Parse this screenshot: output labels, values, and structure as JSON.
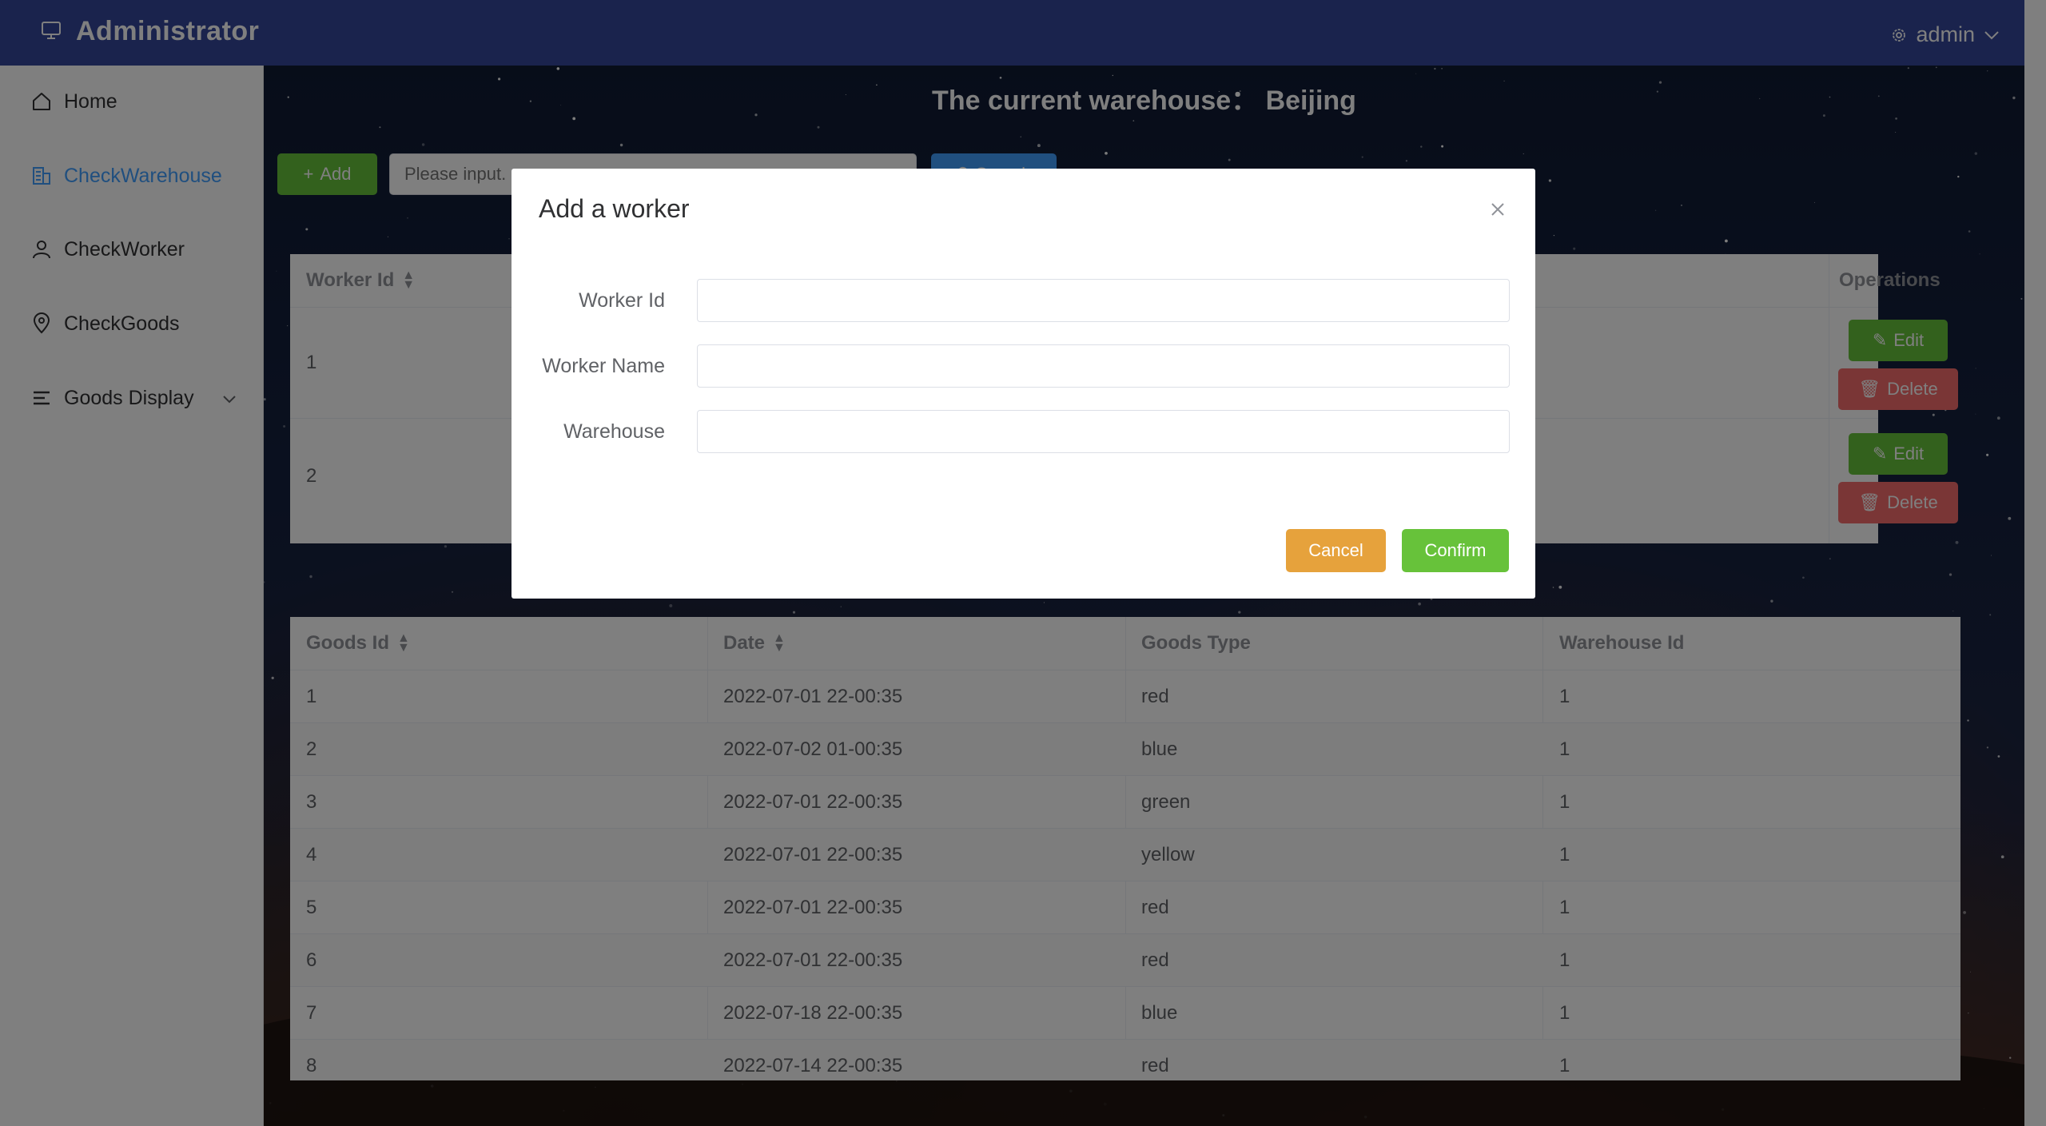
{
  "header": {
    "app_title": "Administrator",
    "user_name": "admin",
    "icons": {
      "app": "monitor-icon",
      "user": "gear-icon",
      "dropdown": "chevron-down-icon"
    },
    "color": "#34469a"
  },
  "sidebar": {
    "items": [
      {
        "label": "Home",
        "icon": "home-icon",
        "active": false
      },
      {
        "label": "CheckWarehouse",
        "icon": "office-building-icon",
        "active": true
      },
      {
        "label": "CheckWorker",
        "icon": "user-icon",
        "active": false
      },
      {
        "label": "CheckGoods",
        "icon": "location-pin-icon",
        "active": false
      },
      {
        "label": "Goods Display",
        "icon": "list-icon",
        "active": false,
        "expandable": true
      }
    ],
    "active_color": "#409eff"
  },
  "main": {
    "warehouse_title": "The current warehouse： Beijing",
    "toolbar": {
      "add_label": "Add",
      "search_placeholder": "Please input.",
      "search_label": "Search"
    },
    "worker_table": {
      "headers": {
        "worker_id": "Worker Id",
        "operations": "Operations"
      },
      "rows": [
        {
          "worker_id": "1"
        },
        {
          "worker_id": "2"
        }
      ],
      "edit_label": "Edit",
      "delete_label": "Delete"
    },
    "goods_table": {
      "headers": {
        "goods_id": "Goods Id",
        "date": "Date",
        "goods_type": "Goods Type",
        "warehouse_id": "Warehouse Id"
      },
      "rows": [
        {
          "goods_id": "1",
          "date": "2022-07-01 22-00:35",
          "goods_type": "red",
          "warehouse_id": "1"
        },
        {
          "goods_id": "2",
          "date": "2022-07-02 01-00:35",
          "goods_type": "blue",
          "warehouse_id": "1"
        },
        {
          "goods_id": "3",
          "date": "2022-07-01 22-00:35",
          "goods_type": "green",
          "warehouse_id": "1"
        },
        {
          "goods_id": "4",
          "date": "2022-07-01 22-00:35",
          "goods_type": "yellow",
          "warehouse_id": "1"
        },
        {
          "goods_id": "5",
          "date": "2022-07-01 22-00:35",
          "goods_type": "red",
          "warehouse_id": "1"
        },
        {
          "goods_id": "6",
          "date": "2022-07-01 22-00:35",
          "goods_type": "red",
          "warehouse_id": "1"
        },
        {
          "goods_id": "7",
          "date": "2022-07-18 22-00:35",
          "goods_type": "blue",
          "warehouse_id": "1"
        },
        {
          "goods_id": "8",
          "date": "2022-07-14 22-00:35",
          "goods_type": "red",
          "warehouse_id": "1"
        }
      ]
    }
  },
  "dialog": {
    "title": "Add a worker",
    "fields": [
      {
        "label": "Worker Id",
        "value": ""
      },
      {
        "label": "Worker Name",
        "value": ""
      },
      {
        "label": "Warehouse",
        "value": ""
      }
    ],
    "cancel_label": "Cancel",
    "confirm_label": "Confirm",
    "colors": {
      "cancel": "#e6a23c",
      "confirm": "#67c23a"
    }
  }
}
